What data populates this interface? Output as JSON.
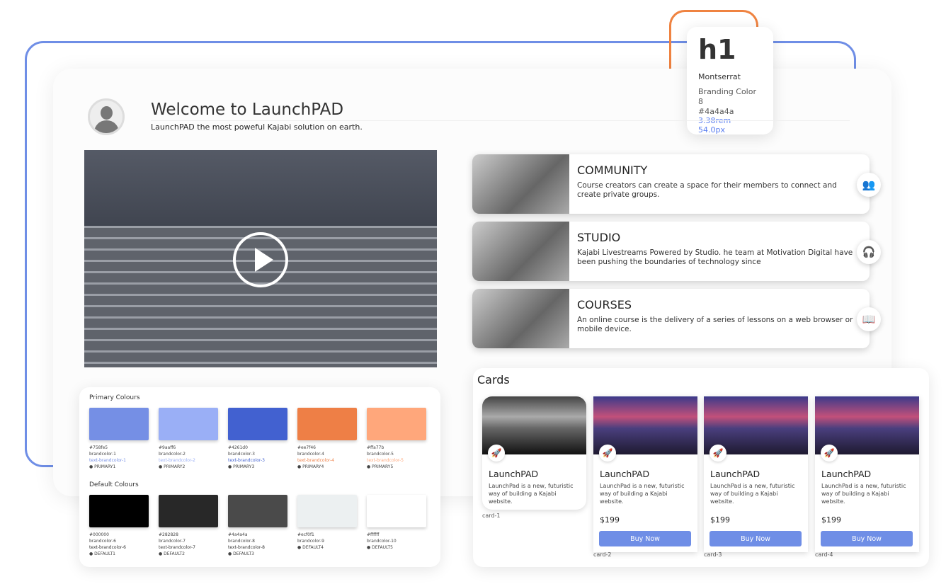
{
  "typography": {
    "sample": "h1",
    "font": "Montserrat",
    "color_name": "Branding Color 8",
    "hex": "#4a4a4a",
    "rem": "3.38rem",
    "px": "54.0px"
  },
  "header": {
    "title": "Welcome to LaunchPAD",
    "subtitle": "LaunchPAD the most poweful Kajabi solution on earth."
  },
  "features": [
    {
      "title": "COMMUNITY",
      "text": "Course creators can create a space for their members to connect and create private groups.",
      "icon": "people-icon"
    },
    {
      "title": "STUDIO",
      "text": "Kajabi Livestreams Powered by Studio. he team at Motivation Digital have been pushing the boundaries of technology since",
      "icon": "headset-icon"
    },
    {
      "title": "COURSES",
      "text": "An online course is the delivery of a series of lessons on a web browser or mobile device.",
      "icon": "book-icon"
    }
  ],
  "palette": {
    "primary_title": "Primary Colours",
    "default_title": "Default Colours",
    "primary": [
      {
        "hex": "#758fe5",
        "name": "brandcolor-1",
        "text": "text-brandcolor-1",
        "tag": "PRIMARY1",
        "color": "#758fe5"
      },
      {
        "hex": "#9aaff6",
        "name": "brandcolor-2",
        "text": "text-brandcolor-2",
        "tag": "PRIMARY2",
        "color": "#9aaff6"
      },
      {
        "hex": "#4261d0",
        "name": "brandcolor-3",
        "text": "text-brandcolor-3",
        "tag": "PRIMARY3",
        "color": "#4261d0"
      },
      {
        "hex": "#ee7f46",
        "name": "brandcolor-4",
        "text": "text-brandcolor-4",
        "tag": "PRIMARY4",
        "color": "#ee7f46"
      },
      {
        "hex": "#ffa77b",
        "name": "brandcolor-5",
        "text": "text-brandcolor-5",
        "tag": "PRIMARY5",
        "color": "#ffa77b"
      }
    ],
    "default": [
      {
        "hex": "#000000",
        "name": "brandcolor-6",
        "text": "text-brandcolor-6",
        "tag": "DEFAULT1",
        "color": "#000000"
      },
      {
        "hex": "#282828",
        "name": "brandcolor-7",
        "text": "text-brandcolor-7",
        "tag": "DEFAULT2",
        "color": "#282828"
      },
      {
        "hex": "#4a4a4a",
        "name": "brandcolor-8",
        "text": "text-brandcolor-8",
        "tag": "DEFAULT3",
        "color": "#4a4a4a"
      },
      {
        "hex": "#ecf0f1",
        "name": "brandcolor-9",
        "text": "",
        "tag": "DEFAULT4",
        "color": "#ecf0f1"
      },
      {
        "hex": "#ffffff",
        "name": "brandcolor-10",
        "text": "",
        "tag": "DEFAULT5",
        "color": "#ffffff"
      }
    ]
  },
  "cards": {
    "title": "Cards",
    "items": [
      {
        "title": "LaunchPAD",
        "text": "LaunchPad is a new, futuristic way of building a Kajabi website.",
        "label": "card-1"
      },
      {
        "title": "LaunchPAD",
        "text": "LaunchPad is a new, futuristic way of building a Kajabi website.",
        "price": "$199",
        "button": "Buy Now",
        "label": "card-2"
      },
      {
        "title": "LaunchPAD",
        "text": "LaunchPad is a new, futuristic way of building a Kajabi website.",
        "price": "$199",
        "button": "Buy Now",
        "label": "card-3"
      },
      {
        "title": "LaunchPAD",
        "text": "LaunchPad is a new, futuristic way of building a Kajabi website.",
        "price": "$199",
        "button": "Buy Now",
        "label": "card-4"
      }
    ]
  }
}
